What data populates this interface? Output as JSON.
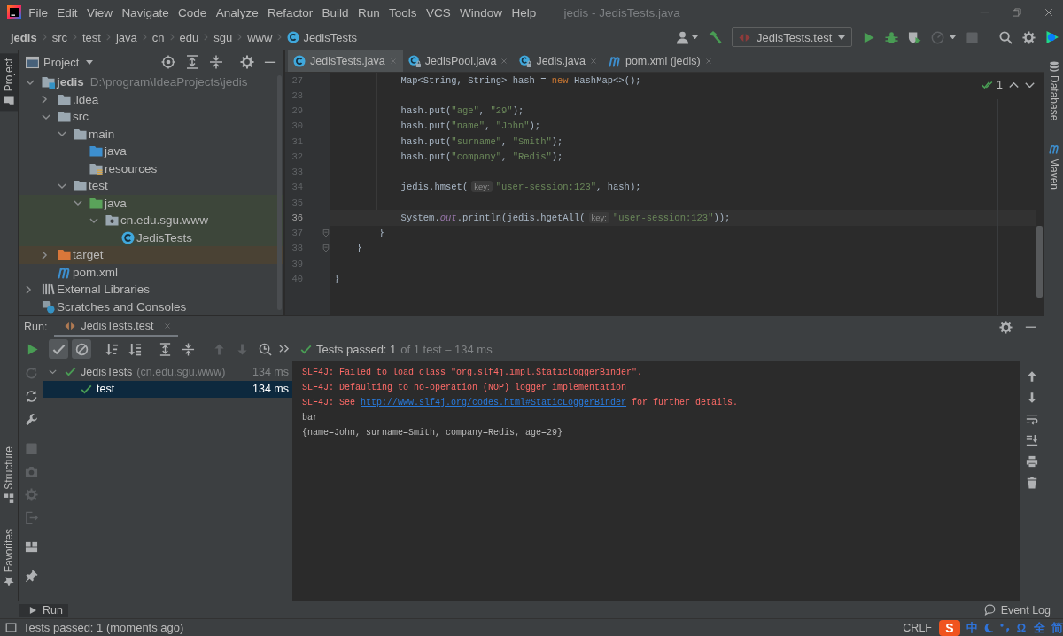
{
  "window": {
    "title": "jedis - JedisTests.java"
  },
  "menu": [
    "File",
    "Edit",
    "View",
    "Navigate",
    "Code",
    "Analyze",
    "Refactor",
    "Build",
    "Run",
    "Tools",
    "VCS",
    "Window",
    "Help"
  ],
  "breadcrumbs": [
    {
      "label": "jedis",
      "kind": "project"
    },
    {
      "label": "src",
      "kind": "folder"
    },
    {
      "label": "test",
      "kind": "folder"
    },
    {
      "label": "java",
      "kind": "folder"
    },
    {
      "label": "cn",
      "kind": "folder"
    },
    {
      "label": "edu",
      "kind": "folder"
    },
    {
      "label": "sgu",
      "kind": "folder"
    },
    {
      "label": "www",
      "kind": "folder"
    },
    {
      "label": "JedisTests",
      "kind": "class"
    }
  ],
  "navbar": {
    "run_config": "JedisTests.test",
    "actions": [
      {
        "kind": "run",
        "disabled": false
      },
      {
        "kind": "debug",
        "disabled": false
      },
      {
        "kind": "coverage",
        "disabled": false
      },
      {
        "kind": "profile",
        "disabled": true
      },
      {
        "kind": "stop",
        "disabled": true
      }
    ]
  },
  "tool_windows": {
    "left_top": [
      {
        "label": "Project",
        "kind": "project",
        "selected": true
      }
    ],
    "left_bottom": [
      {
        "label": "Structure",
        "kind": "structure",
        "selected": false
      },
      {
        "label": "Favorites",
        "kind": "favorites",
        "selected": false
      }
    ],
    "right": [
      {
        "label": "Database",
        "kind": "database",
        "selected": false
      },
      {
        "label": "Maven",
        "kind": "maven",
        "selected": false
      }
    ]
  },
  "project_panel": {
    "title": "Project",
    "tree": [
      {
        "label": "jedis",
        "kind": "module",
        "path": "D:\\program\\IdeaProjects\\jedis",
        "expanded": true,
        "children": [
          {
            "label": ".idea",
            "kind": "folder",
            "expanded": false
          },
          {
            "label": "src",
            "kind": "folder",
            "expanded": true,
            "children": [
              {
                "label": "main",
                "kind": "folder",
                "expanded": true,
                "children": [
                  {
                    "label": "java",
                    "kind": "sources"
                  },
                  {
                    "label": "resources",
                    "kind": "resources"
                  }
                ]
              },
              {
                "label": "test",
                "kind": "folder",
                "expanded": true,
                "children": [
                  {
                    "label": "java",
                    "kind": "tests",
                    "color": "#3d463a",
                    "expanded": true,
                    "children": [
                      {
                        "label": "cn.edu.sgu.www",
                        "kind": "package",
                        "expanded": true,
                        "children": [
                          {
                            "label": "JedisTests",
                            "kind": "class"
                          }
                        ]
                      }
                    ]
                  }
                ]
              }
            ]
          },
          {
            "label": "target",
            "kind": "excluded",
            "color": "#4a4234",
            "expanded": false
          },
          {
            "label": "pom.xml",
            "kind": "maven"
          }
        ]
      },
      {
        "label": "External Libraries",
        "kind": "libraries",
        "expanded": false
      },
      {
        "label": "Scratches and Consoles",
        "kind": "scratches"
      }
    ]
  },
  "editor": {
    "tabs": [
      {
        "label": "JedisTests.java",
        "kind": "class",
        "selected": true
      },
      {
        "label": "JedisPool.java",
        "kind": "library",
        "selected": false
      },
      {
        "label": "Jedis.java",
        "kind": "library",
        "selected": false
      },
      {
        "label": "pom.xml (jedis)",
        "kind": "maven",
        "selected": false
      }
    ],
    "inspection": {
      "count": "1"
    },
    "lines": [
      {
        "number": "27",
        "current": false,
        "fold": false,
        "tokens": [
          {
            "text": "            Map<String, String> hash = ",
            "kind": "plain"
          },
          {
            "text": "new",
            "kind": "keyword"
          },
          {
            "text": " HashMap<>();",
            "kind": "plain"
          }
        ]
      },
      {
        "number": "28",
        "current": false,
        "fold": false
      },
      {
        "number": "29",
        "current": false,
        "fold": false,
        "tokens": [
          {
            "text": "            hash.put(",
            "kind": "plain"
          },
          {
            "text": "\"age\"",
            "kind": "string"
          },
          {
            "text": ", ",
            "kind": "plain"
          },
          {
            "text": "\"29\"",
            "kind": "string"
          },
          {
            "text": ");",
            "kind": "plain"
          }
        ]
      },
      {
        "number": "30",
        "current": false,
        "fold": false,
        "tokens": [
          {
            "text": "            hash.put(",
            "kind": "plain"
          },
          {
            "text": "\"name\"",
            "kind": "string"
          },
          {
            "text": ", ",
            "kind": "plain"
          },
          {
            "text": "\"John\"",
            "kind": "string"
          },
          {
            "text": ");",
            "kind": "plain"
          }
        ]
      },
      {
        "number": "31",
        "current": false,
        "fold": false,
        "tokens": [
          {
            "text": "            hash.put(",
            "kind": "plain"
          },
          {
            "text": "\"surname\"",
            "kind": "string"
          },
          {
            "text": ", ",
            "kind": "plain"
          },
          {
            "text": "\"Smith\"",
            "kind": "string"
          },
          {
            "text": ");",
            "kind": "plain"
          }
        ]
      },
      {
        "number": "32",
        "current": false,
        "fold": false,
        "tokens": [
          {
            "text": "            hash.put(",
            "kind": "plain"
          },
          {
            "text": "\"company\"",
            "kind": "string"
          },
          {
            "text": ", ",
            "kind": "plain"
          },
          {
            "text": "\"Redis\"",
            "kind": "string"
          },
          {
            "text": ");",
            "kind": "plain"
          }
        ]
      },
      {
        "number": "33",
        "current": false,
        "fold": false
      },
      {
        "number": "34",
        "current": false,
        "fold": false,
        "tokens": [
          {
            "text": "            jedis.hmset(",
            "kind": "plain"
          },
          {
            "text": "key:",
            "kind": "hint"
          },
          {
            "text": "\"user-session:123\"",
            "kind": "string"
          },
          {
            "text": ", hash);",
            "kind": "plain"
          }
        ]
      },
      {
        "number": "35",
        "current": false,
        "fold": false
      },
      {
        "number": "36",
        "current": true,
        "fold": false,
        "tokens": [
          {
            "text": "            System.",
            "kind": "plain"
          },
          {
            "text": "out",
            "kind": "field"
          },
          {
            "text": ".println(jedis.hgetAll(",
            "kind": "plain"
          },
          {
            "text": "key:",
            "kind": "hint"
          },
          {
            "text": "\"user-session:123\"",
            "kind": "string"
          },
          {
            "text": "));",
            "kind": "plain"
          }
        ]
      },
      {
        "number": "37",
        "current": false,
        "fold": true,
        "tokens": [
          {
            "text": "        }",
            "kind": "plain"
          }
        ]
      },
      {
        "number": "38",
        "current": false,
        "fold": true,
        "tokens": [
          {
            "text": "    }",
            "kind": "plain"
          }
        ]
      },
      {
        "number": "39",
        "current": false,
        "fold": false
      },
      {
        "number": "40",
        "current": false,
        "fold": false,
        "tokens": [
          {
            "text": "}",
            "kind": "plain"
          }
        ]
      }
    ]
  },
  "run_panel": {
    "label": "Run:",
    "tabs": [
      {
        "label": "JedisTests.test",
        "selected": true
      }
    ],
    "toolbar": [
      {
        "kind": "run",
        "pressed": false,
        "disabled": false
      },
      {
        "kind": "passed",
        "pressed": true,
        "disabled": false
      },
      {
        "kind": "ignored",
        "pressed": true,
        "disabled": false
      },
      {
        "kind": "sortname",
        "pressed": false,
        "disabled": false
      },
      {
        "kind": "sortduration",
        "pressed": false,
        "disabled": false
      },
      {
        "kind": "expand",
        "pressed": false,
        "disabled": false
      },
      {
        "kind": "collapse",
        "pressed": false,
        "disabled": false
      },
      {
        "kind": "previous",
        "pressed": false,
        "disabled": true
      },
      {
        "kind": "next",
        "pressed": false,
        "disabled": true
      },
      {
        "kind": "history",
        "pressed": false,
        "disabled": false
      },
      {
        "kind": "more",
        "pressed": false,
        "disabled": false
      }
    ],
    "summary": {
      "count": "Tests passed: 1",
      "detail": "of 1 test – 134 ms"
    },
    "side_toolbar": [
      {
        "kind": "rerunfailed",
        "disabled": true
      },
      {
        "kind": "autotest",
        "disabled": false
      },
      {
        "kind": "settings",
        "disabled": false
      },
      {
        "kind": "stop",
        "disabled": true
      },
      {
        "kind": "dump",
        "disabled": true
      },
      {
        "kind": "options",
        "disabled": true
      },
      {
        "kind": "exit",
        "disabled": true
      },
      {
        "kind": "layout",
        "disabled": false
      },
      {
        "kind": "pin",
        "disabled": false
      }
    ],
    "tests": [
      {
        "label": "JedisTests",
        "detail": "(cn.edu.sgu.www)",
        "time": "134 ms",
        "kind": "passed",
        "expanded": true,
        "selected": false,
        "children": [
          {
            "label": "test",
            "time": "134 ms",
            "kind": "passed",
            "selected": true
          }
        ]
      }
    ],
    "console": [
      {
        "kind": "stderr",
        "parts": [
          {
            "text": "SLF4J: Failed to load class \"org.slf4j.impl.StaticLoggerBinder\".",
            "kind": "text"
          }
        ]
      },
      {
        "kind": "stderr",
        "parts": [
          {
            "text": "SLF4J: Defaulting to no-operation (NOP) logger implementation",
            "kind": "text"
          }
        ]
      },
      {
        "kind": "stderr",
        "parts": [
          {
            "text": "SLF4J: See ",
            "kind": "text"
          },
          {
            "text": "http://www.slf4j.org/codes.html#StaticLoggerBinder",
            "kind": "link"
          },
          {
            "text": " for further details.",
            "kind": "text"
          }
        ]
      },
      {
        "kind": "stdout",
        "parts": [
          {
            "text": "bar",
            "kind": "text"
          }
        ]
      },
      {
        "kind": "stdout",
        "parts": [
          {
            "text": "{name=John, surname=Smith, company=Redis, age=29}",
            "kind": "text"
          }
        ]
      }
    ]
  },
  "bottom_bar": {
    "left": [
      {
        "label": "Run",
        "kind": "run",
        "selected": true
      }
    ],
    "right": [
      {
        "label": "Event Log",
        "kind": "eventlog",
        "selected": false
      }
    ]
  },
  "status_bar": {
    "message": "Tests passed: 1 (moments ago)",
    "line_separator": "CRLF",
    "ime": [
      {
        "kind": "logo",
        "text": "S"
      },
      {
        "kind": "char",
        "text": "中"
      },
      {
        "kind": "moon"
      },
      {
        "kind": "punct"
      },
      {
        "kind": "char",
        "text": "Ω"
      },
      {
        "kind": "char",
        "text": "全"
      },
      {
        "kind": "char",
        "text": "简"
      }
    ]
  }
}
